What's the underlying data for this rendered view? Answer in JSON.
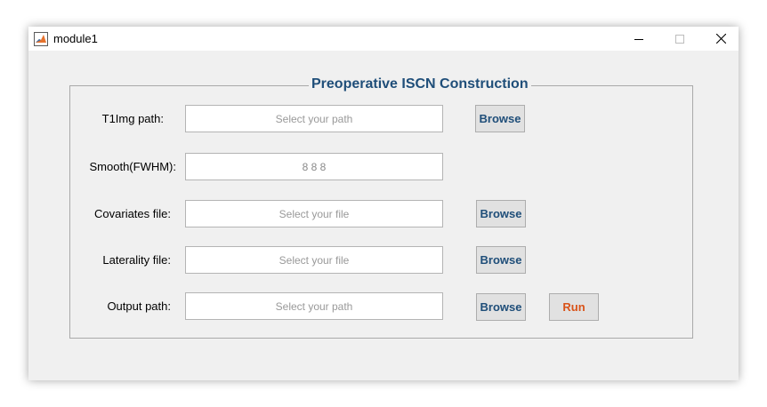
{
  "window": {
    "title": "module1",
    "app_icon": "matlab-icon",
    "controls": [
      "minimize-icon",
      "maximize-icon",
      "close-icon"
    ]
  },
  "panel": {
    "title": "Preoperative ISCN Construction",
    "title_color": "#1f4e79"
  },
  "rows": [
    {
      "label": "T1Img path:",
      "placeholder": "Select your path",
      "button": "Browse"
    },
    {
      "label": "Smooth(FWHM):",
      "value": "8 8 8"
    },
    {
      "label": "Covariates file:",
      "placeholder": "Select your file",
      "button": "Browse"
    },
    {
      "label": "Laterality file:",
      "placeholder": "Select your file",
      "button": "Browse"
    },
    {
      "label": "Output path:",
      "placeholder": "Select your path",
      "button": "Browse"
    }
  ],
  "run_button": {
    "label": "Run",
    "color": "#d95319"
  }
}
